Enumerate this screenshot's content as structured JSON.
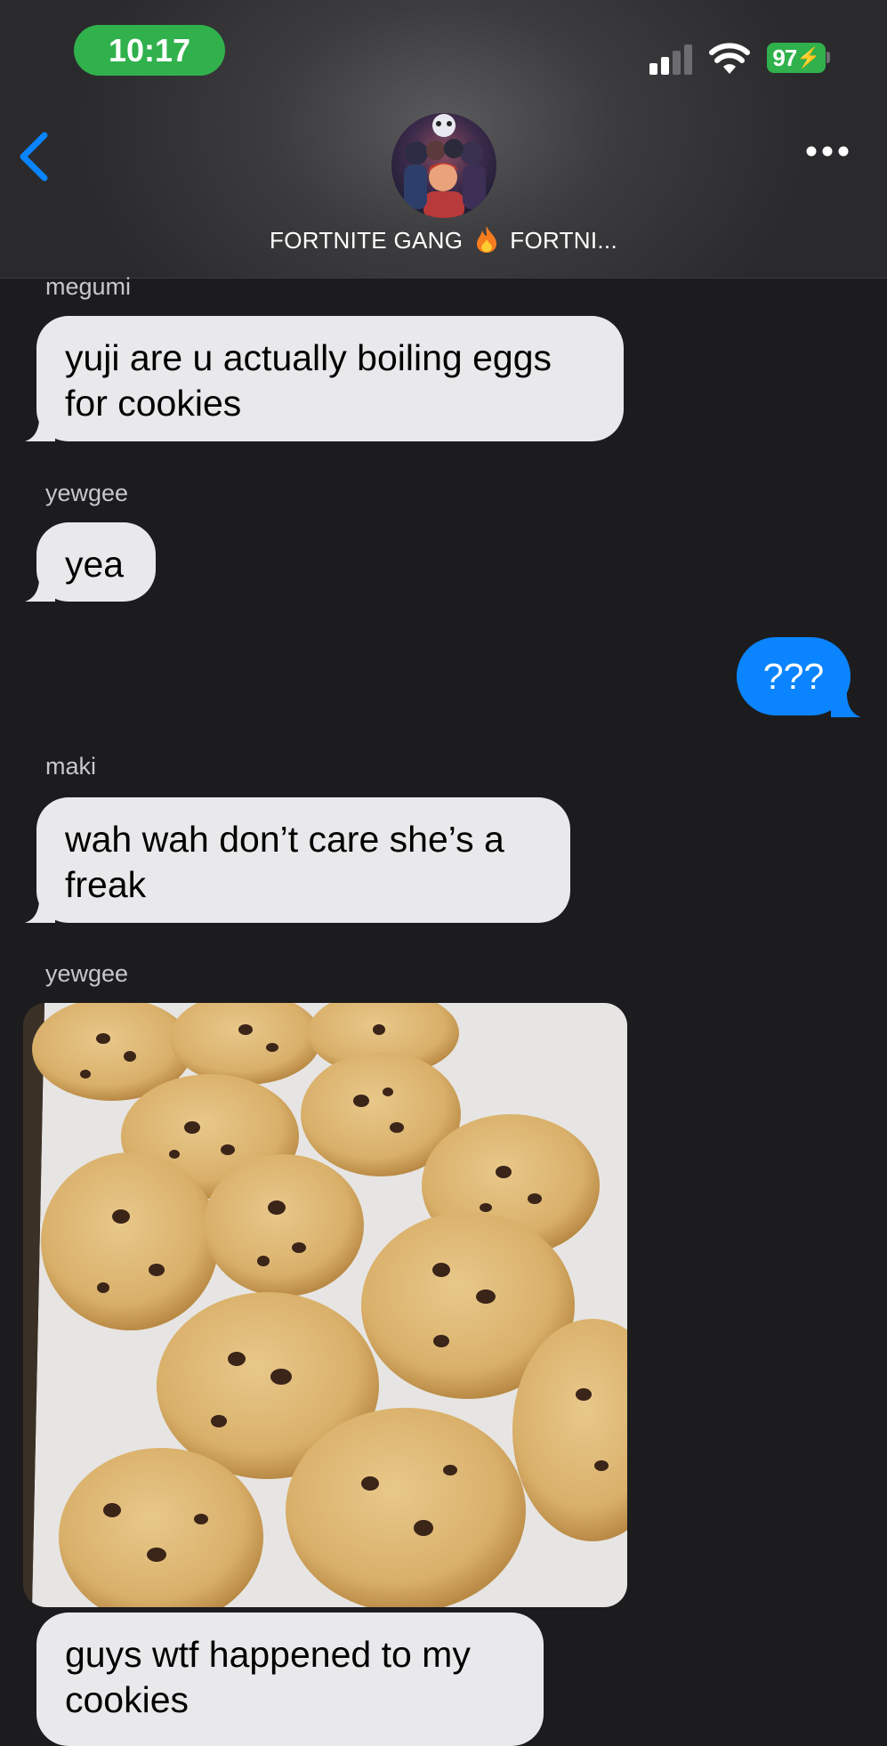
{
  "status_bar": {
    "time": "10:17",
    "battery": "97"
  },
  "header": {
    "group_name_left": "FORTNITE GANG",
    "group_name_right": "FORTNI..."
  },
  "messages": [
    {
      "sender": "megumi",
      "text": "yuji are u actually boiling eggs for cookies"
    },
    {
      "sender": "yewgee",
      "text": "yea"
    },
    {
      "sender": "me",
      "text": "???"
    },
    {
      "sender": "maki",
      "text": "wah wah don’t care she’s a freak"
    },
    {
      "sender": "yewgee",
      "type": "photo",
      "description": "chocolate-chip-cookies-photo",
      "text": "guys wtf happened to my cookies"
    }
  ],
  "colors": {
    "outgoing": "#0a84ff",
    "incoming": "#e9e9eb",
    "background": "#1c1c1e",
    "accent_green": "#30b14c",
    "back_blue": "#0a84ff"
  },
  "icons": [
    "back-chevron-icon",
    "more-icon",
    "signal-icon",
    "wifi-icon",
    "battery-icon",
    "flame-icon"
  ]
}
